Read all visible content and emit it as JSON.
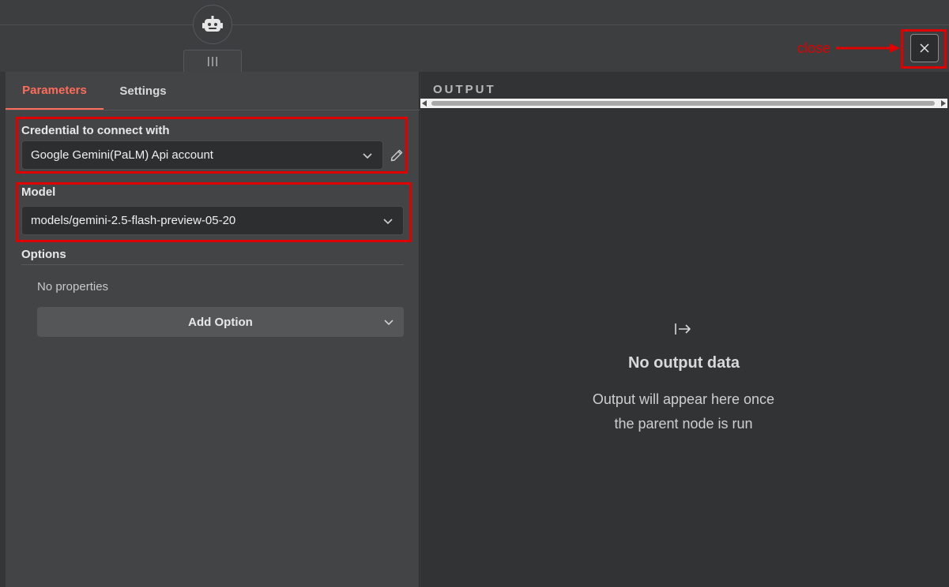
{
  "tabs": [
    {
      "label": "Parameters",
      "active": true
    },
    {
      "label": "Settings",
      "active": false
    }
  ],
  "credential": {
    "label": "Credential to connect with",
    "value": "Google Gemini(PaLM) Api account"
  },
  "model": {
    "label": "Model",
    "value": "models/gemini-2.5-flash-preview-05-20"
  },
  "options": {
    "label": "Options",
    "empty_text": "No properties",
    "add_label": "Add Option"
  },
  "output": {
    "label": "OUTPUT",
    "empty_title": "No output data",
    "empty_description": "Output will appear here once the parent node is run"
  },
  "annotation": {
    "close_text": "close"
  },
  "icons": {
    "node": "robot-icon",
    "handle": "drag-handle-icon",
    "edit": "pencil-icon",
    "output_empty": "arrow-right-to-bar-icon",
    "close": "close-icon"
  },
  "colors": {
    "accent": "#ff6d5a",
    "highlight": "#e00000"
  }
}
